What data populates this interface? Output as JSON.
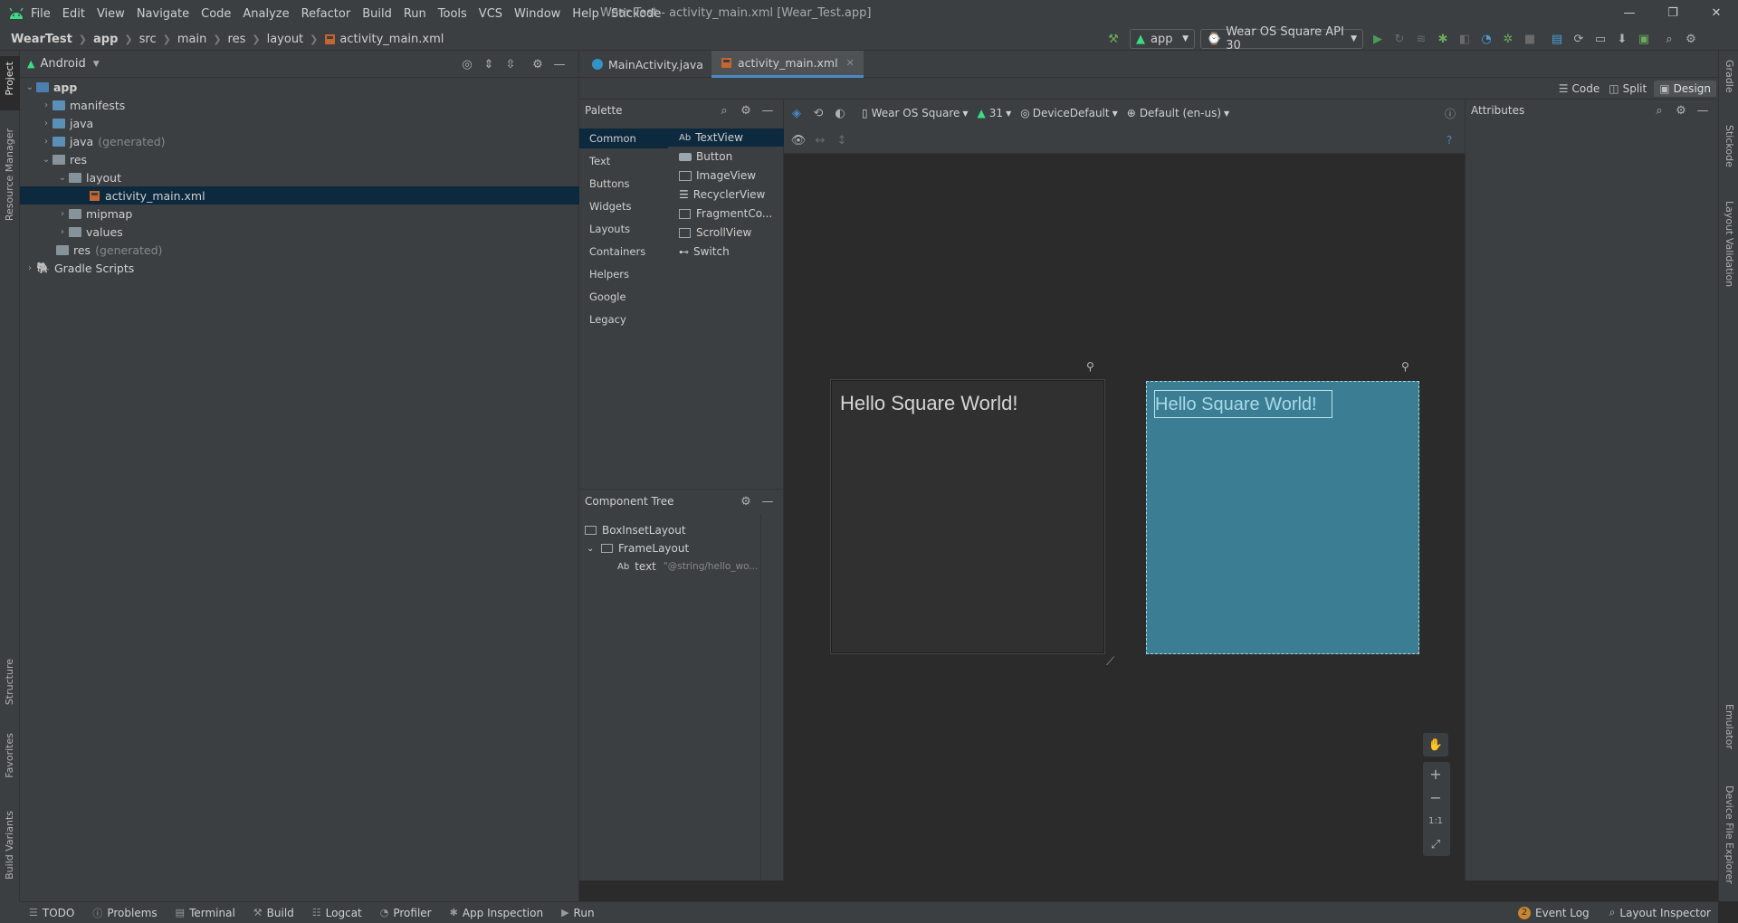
{
  "menu": [
    "File",
    "Edit",
    "View",
    "Navigate",
    "Code",
    "Analyze",
    "Refactor",
    "Build",
    "Run",
    "Tools",
    "VCS",
    "Window",
    "Help",
    "Stickode"
  ],
  "window_title": "Wear Test - activity_main.xml [Wear_Test.app]",
  "window_controls": {
    "minimize": "—",
    "restore": "❐",
    "close": "✕"
  },
  "breadcrumbs": [
    "WearTest",
    "app",
    "src",
    "main",
    "res",
    "layout",
    "activity_main.xml"
  ],
  "run_config": {
    "module": "app",
    "device": "Wear OS Square API 30"
  },
  "project_panel": {
    "view_mode": "Android",
    "tree": [
      {
        "label": "app",
        "depth": 0,
        "expanded": true,
        "kind": "module"
      },
      {
        "label": "manifests",
        "depth": 1,
        "expanded": false,
        "kind": "folder"
      },
      {
        "label": "java",
        "depth": 1,
        "expanded": false,
        "kind": "folder"
      },
      {
        "label": "java",
        "suffix": "(generated)",
        "depth": 1,
        "expanded": false,
        "kind": "folder"
      },
      {
        "label": "res",
        "depth": 1,
        "expanded": true,
        "kind": "folder"
      },
      {
        "label": "layout",
        "depth": 2,
        "expanded": true,
        "kind": "folder"
      },
      {
        "label": "activity_main.xml",
        "depth": 3,
        "selected": true,
        "kind": "file"
      },
      {
        "label": "mipmap",
        "depth": 2,
        "expanded": false,
        "kind": "folder"
      },
      {
        "label": "values",
        "depth": 2,
        "expanded": false,
        "kind": "folder"
      },
      {
        "label": "res",
        "suffix": "(generated)",
        "depth": 1,
        "kind": "folder"
      },
      {
        "label": "Gradle Scripts",
        "depth": 0,
        "expanded": false,
        "kind": "gradle"
      }
    ]
  },
  "left_stripe": {
    "project": "Project",
    "resource_manager": "Resource Manager",
    "structure": "Structure",
    "favorites": "Favorites",
    "build_variants": "Build Variants"
  },
  "right_stripe": {
    "gradle": "Gradle",
    "stickode": "Stickode",
    "layout_validation": "Layout Validation",
    "emulator": "Emulator",
    "device_file_explorer": "Device File Explorer"
  },
  "editor_tabs": [
    {
      "label": "MainActivity.java",
      "active": false
    },
    {
      "label": "activity_main.xml",
      "active": true
    }
  ],
  "view_modes": {
    "code": "Code",
    "split": "Split",
    "design": "Design",
    "active": "Design"
  },
  "palette": {
    "title": "Palette",
    "categories": [
      "Common",
      "Text",
      "Buttons",
      "Widgets",
      "Layouts",
      "Containers",
      "Helpers",
      "Google",
      "Legacy"
    ],
    "selected_category": "Common",
    "items": [
      "TextView",
      "Button",
      "ImageView",
      "RecyclerView",
      "FragmentCo...",
      "ScrollView",
      "Switch"
    ],
    "items_prefix": "Ab"
  },
  "component_tree": {
    "title": "Component Tree",
    "nodes": [
      {
        "label": "BoxInsetLayout",
        "depth": 0
      },
      {
        "label": "FrameLayout",
        "depth": 1,
        "expanded": true
      },
      {
        "label": "text",
        "prefix": "Ab",
        "value": "\"@string/hello_wo...",
        "depth": 2
      }
    ]
  },
  "design_toolbar": {
    "device": "Wear OS Square",
    "api": "31",
    "theme": "DeviceDefault",
    "locale": "Default (en-us)"
  },
  "preview": {
    "text": "Hello Square World!"
  },
  "blueprint": {
    "text": "Hello Square World!"
  },
  "zoom_controls": {
    "pan": "✋",
    "zoom_in": "+",
    "zoom_out": "−",
    "actual": "1:1",
    "fit": "⤢"
  },
  "attributes": {
    "title": "Attributes"
  },
  "bottom_tools": [
    "TODO",
    "Problems",
    "Terminal",
    "Build",
    "Logcat",
    "Profiler",
    "App Inspection",
    "Run"
  ],
  "bottom_right": {
    "event_log": "Event Log",
    "event_count": "2",
    "layout_inspector": "Layout Inspector"
  },
  "colors": {
    "blueprint_bg": "#3b7e93",
    "selection": "#0d293e",
    "accent": "#4a88c7",
    "android_green": "#3ddc84"
  }
}
